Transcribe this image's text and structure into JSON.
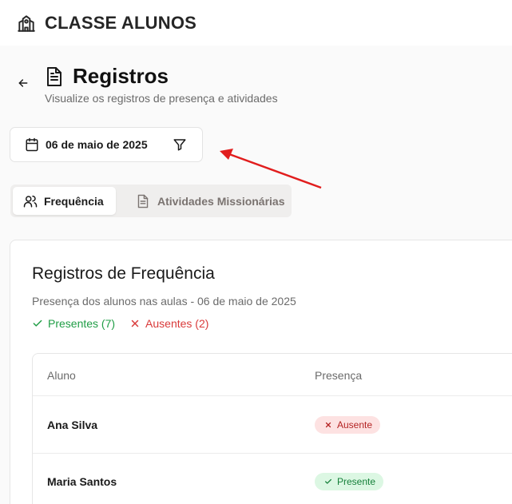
{
  "header": {
    "app_title": "CLASSE ALUNOS",
    "logo_icon": "school-building-icon"
  },
  "page": {
    "title": "Registros",
    "subtitle": "Visualize os registros de presença e atividades",
    "back_icon": "arrow-left-icon",
    "title_icon": "document-icon"
  },
  "date_filter": {
    "value": "06 de maio de 2025",
    "calendar_icon": "calendar-icon",
    "filter_icon": "filter-icon"
  },
  "tabs": [
    {
      "label": "Frequência",
      "icon": "users-icon",
      "active": true
    },
    {
      "label": "Atividades Missionárias",
      "icon": "document-icon",
      "active": false
    }
  ],
  "attendance": {
    "title": "Registros de Frequência",
    "subtitle": "Presença dos alunos nas aulas - 06 de maio de 2025",
    "present_summary": "Presentes (7)",
    "absent_summary": "Ausentes (2)",
    "columns": [
      "Aluno",
      "Presença"
    ],
    "rows": [
      {
        "name": "Ana Silva",
        "status": "Ausente"
      },
      {
        "name": "Maria Santos",
        "status": "Presente"
      }
    ]
  },
  "colors": {
    "present": "#1f9d45",
    "absent": "#d93a3a",
    "annotation_arrow": "#e11d1d"
  }
}
